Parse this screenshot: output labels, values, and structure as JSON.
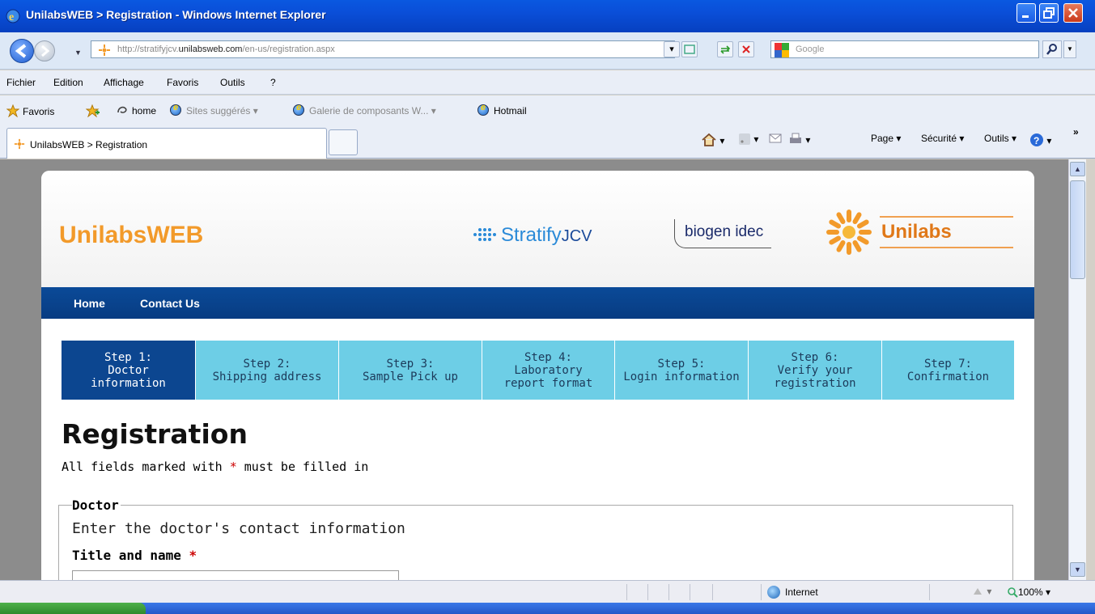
{
  "window": {
    "title": "UnilabsWEB > Registration - Windows Internet Explorer"
  },
  "address": {
    "url_prefix": "http://stratifyjcv.",
    "url_domain": "unilabsweb.com",
    "url_suffix": "/en-us/registration.aspx"
  },
  "search": {
    "placeholder": "Google"
  },
  "menu": [
    "Fichier",
    "Edition",
    "Affichage",
    "Favoris",
    "Outils",
    "?"
  ],
  "favorites": {
    "label": "Favoris",
    "home": "home",
    "suggested": "Sites suggérés ▾",
    "gallery": "Galerie de composants W... ▾",
    "hotmail": "Hotmail"
  },
  "tab": {
    "label": "UnilabsWEB > Registration"
  },
  "commands": {
    "page": "Page ▾",
    "security": "Sécurité ▾",
    "tools": "Outils ▾",
    "more": "»"
  },
  "site": {
    "brand": "UnilabsWEB",
    "stratify": "Stratify",
    "stratify_jcv": "JCV",
    "biogen": "biogen idec",
    "unilabs": "Unilabs",
    "nav": [
      "Home",
      "Contact Us"
    ]
  },
  "steps": [
    {
      "line1": "Step 1:",
      "line2": "Doctor",
      "line3": "information",
      "active": true
    },
    {
      "line1": "Step 2:",
      "line2": "Shipping address",
      "line3": ""
    },
    {
      "line1": "Step 3:",
      "line2": "Sample Pick up",
      "line3": ""
    },
    {
      "line1": "Step 4:",
      "line2": "Laboratory",
      "line3": "report format"
    },
    {
      "line1": "Step 5:",
      "line2": "Login information",
      "line3": ""
    },
    {
      "line1": "Step 6:",
      "line2": "Verify your",
      "line3": "registration"
    },
    {
      "line1": "Step 7:",
      "line2": "Confirmation",
      "line3": ""
    }
  ],
  "form": {
    "title": "Registration",
    "note_before": "All fields marked with ",
    "note_star": "*",
    "note_after": " must be filled in",
    "section_legend": "Doctor",
    "section_desc": "Enter the doctor's contact information",
    "field_label": "Title and name ",
    "field_star": "*",
    "field_value": ""
  },
  "status": {
    "zone": "Internet",
    "zoom": "100%  ▾"
  },
  "colors": {
    "brand_orange": "#f29a2a",
    "nav_blue": "#0a4a98",
    "step_active": "#0c4690",
    "step_inactive": "#6dcee6"
  }
}
